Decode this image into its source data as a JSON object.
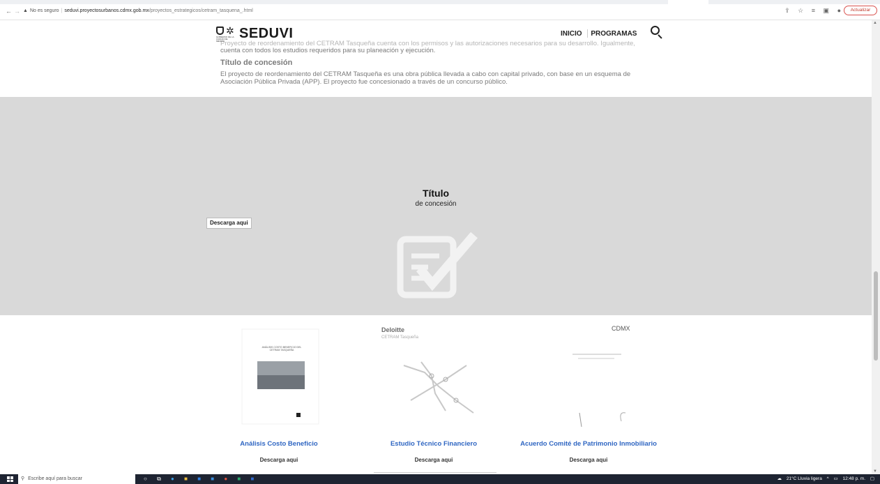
{
  "browser": {
    "back": "←",
    "forward": "→",
    "reload": "C",
    "security_label": "No es seguro",
    "host": "seduvi.proyectosurbanos.cdmx.gob.mx",
    "path": "/proyectos_estrategicos/cetram_tasquena_.html",
    "update_button": "Actualizar",
    "icons": [
      "share-icon",
      "star-icon",
      "playlist-icon",
      "sidebar-icon",
      "profile-icon"
    ]
  },
  "header": {
    "logo_caption": "GOBIERNO DE LA CIUDAD DE MÉXICO",
    "brand": "SEDUVI",
    "nav": [
      "INICIO",
      "PROGRAMAS"
    ]
  },
  "content": {
    "faded_line": "Proyecto de reordenamiento del CETRAM Tasqueña cuenta con los permisos y las autorizaciones necesarios para su desarrollo. Igualmente,",
    "line2": "cuenta con todos los estudios requeridos para su planeación y ejecución.",
    "section_title": "Título de concesión",
    "paragraph": "El proyecto de reordenamiento del CETRAM Tasqueña es una obra pública llevada a cabo con capital privado, con base en un esquema de Asociación Pública Privada (APP). El proyecto fue concesionado a través de un concurso público."
  },
  "hero": {
    "title": "Título",
    "subtitle": "de concesión",
    "download": "Descarga aqui",
    "background": "#d9d9d9"
  },
  "cards": [
    {
      "title": "Análisis Costo Beneficio",
      "download": "Descarga aqui",
      "thumb_heading": "ANÁLISIS COSTO BENEFICIO DEL CETRAM TASQUEÑA"
    },
    {
      "title": "Estudio Técnico Financiero",
      "download": "Descarga aqui",
      "thumb_heading": "Deloitte",
      "thumb_sub": "CETRAM Tasqueña"
    },
    {
      "title": "Acuerdo Comité de Patrimonio Inmobiliario",
      "download": "Descarga aqui",
      "thumb_heading": "CDMX"
    }
  ],
  "taskbar": {
    "search_placeholder": "Escribe aquí para buscar",
    "weather": "21°C  Lluvia ligera",
    "time": "12:48 p. m."
  },
  "colors": {
    "accent": "#2f66c2",
    "taskbar": "#1e2432"
  }
}
